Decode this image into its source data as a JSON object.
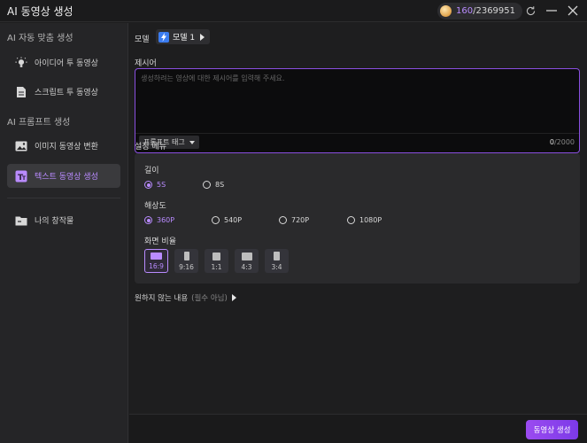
{
  "titlebar": {
    "title": "AI 동영상 생성",
    "credits_used": "160",
    "credits_total": "/2369951",
    "icons": [
      "coin-icon",
      "refresh-icon",
      "minimize-icon",
      "close-icon"
    ]
  },
  "sidebar": {
    "section1": "AI 자동 맞춤 생성",
    "section2": "AI 프롬프트 생성",
    "items": [
      {
        "label": "아이디어 투 동영상",
        "icon": "lightbulb-icon"
      },
      {
        "label": "스크립트 투 동영상",
        "icon": "document-icon"
      },
      {
        "label": "이미지 동영상 변환",
        "icon": "image-icon"
      },
      {
        "label": "텍스트 동영상 생성",
        "icon": "text-icon",
        "active": true
      },
      {
        "label": "나의 창작물",
        "icon": "folder-icon"
      }
    ]
  },
  "main": {
    "model_label": "모델",
    "model_value": "모델 1",
    "prompt_label": "제시어",
    "prompt_placeholder": "생성하려는 영상에 대한 제시어를 입력해 주세요.",
    "tag_button": "프롬프트 태그",
    "counter_current": "0",
    "counter_max": "/2000",
    "settings_label": "설정 메뉴",
    "length_label": "길이",
    "length_options": [
      "5S",
      "8S"
    ],
    "length_selected": "5S",
    "resolution_label": "해상도",
    "resolution_options": [
      "360P",
      "540P",
      "720P",
      "1080P"
    ],
    "resolution_selected": "360P",
    "ratio_label": "화면 비율",
    "ratio_options": [
      "16:9",
      "9:16",
      "1:1",
      "4:3",
      "3:4"
    ],
    "ratio_selected": "16:9",
    "negative_label": "원하지 않는 내용",
    "negative_optional": "(필수 아님)",
    "generate_button": "동영상 생성"
  },
  "colors": {
    "accent": "#b98bff",
    "button_gradient_start": "#9b4bf0",
    "button_gradient_end": "#7c3ae8",
    "model_badge": "#3b7cf0"
  }
}
